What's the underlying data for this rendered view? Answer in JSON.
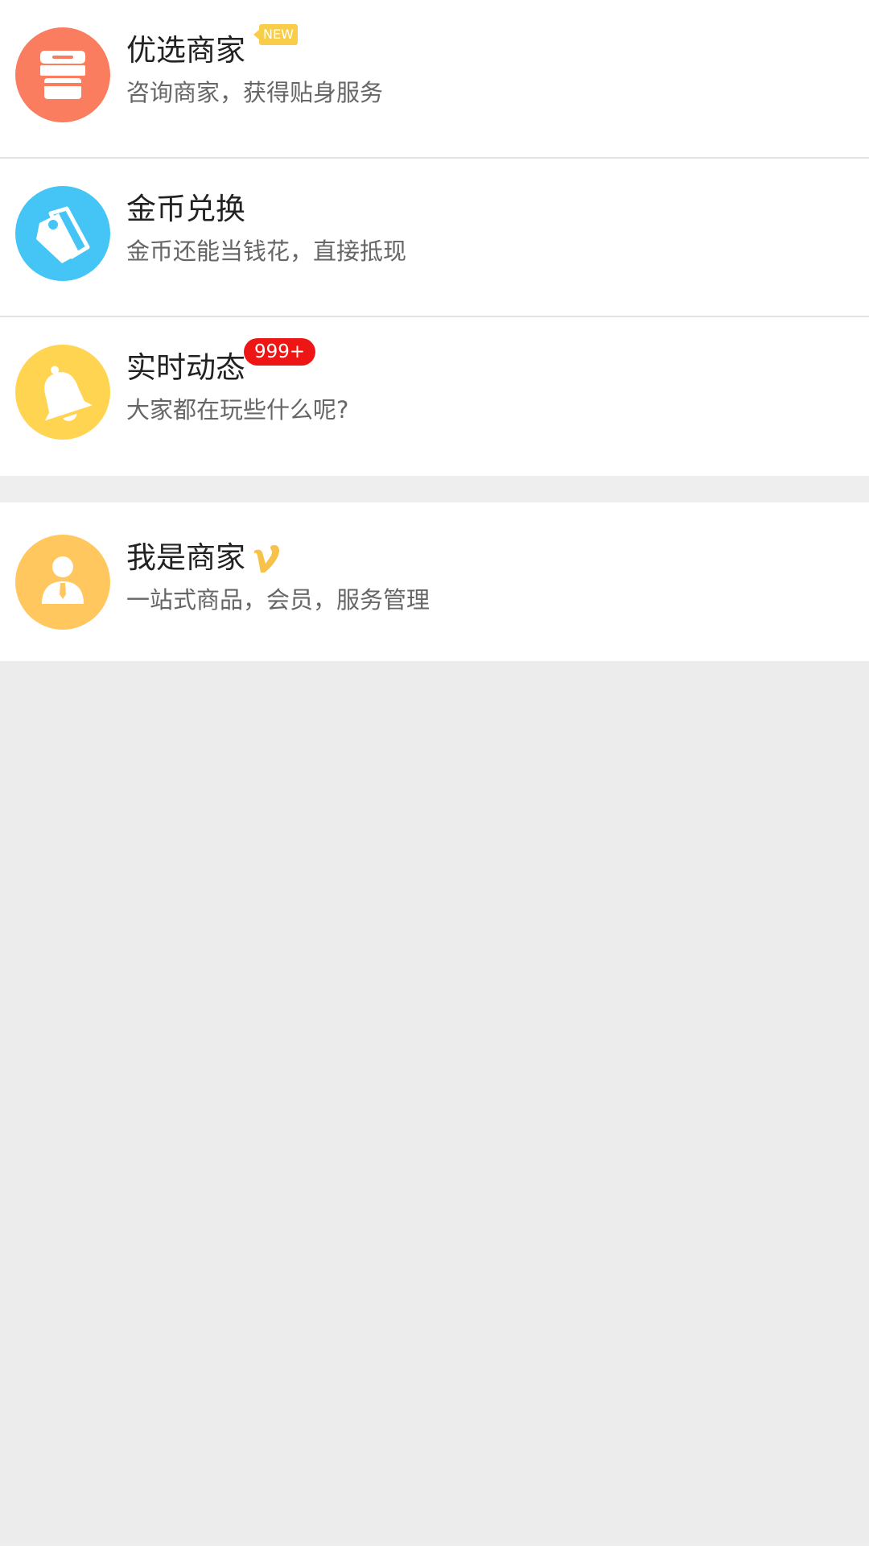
{
  "menu": {
    "items": [
      {
        "title": "优选商家",
        "subtitle": "咨询商家，获得贴身服务",
        "badge": "NEW",
        "icon": "store-icon",
        "color": "#f97d5e"
      },
      {
        "title": "金币兑换",
        "subtitle": "金币还能当钱花，直接抵现",
        "icon": "tag-icon",
        "color": "#45c4f6"
      },
      {
        "title": "实时动态",
        "subtitle": "大家都在玩些什么呢?",
        "badge": "999+",
        "icon": "bell-icon",
        "color": "#ffd450"
      }
    ]
  },
  "merchant": {
    "title": "我是商家",
    "subtitle": "一站式商品，会员，服务管理",
    "badge_icon": "vip-v-icon",
    "icon": "merchant-person-icon",
    "color": "#ffc75d"
  },
  "colors": {
    "background": "#eeeeee",
    "badge_red": "#ee1515",
    "badge_yellow": "#f7cd4a"
  }
}
